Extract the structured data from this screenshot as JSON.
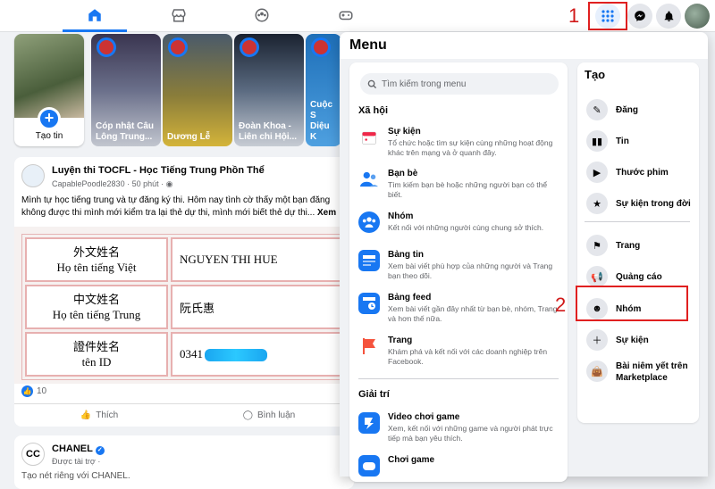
{
  "nav": {
    "home_icon": "home-icon",
    "marketplace_icon": "marketplace-icon",
    "groups_icon": "groups-icon",
    "gaming_icon": "gaming-icon",
    "accent": "#1877f2"
  },
  "annotations": {
    "step1": "1",
    "step2": "2",
    "color": "#e02020"
  },
  "stories": [
    {
      "label": "Tạo tin"
    },
    {
      "label": "Cóp nhật Câu Lông Trung..."
    },
    {
      "label": "Dương Lễ"
    },
    {
      "label": "Đoàn Khoa - Liên chi Hội..."
    },
    {
      "label": "Cuộc S Diệu K"
    }
  ],
  "post": {
    "name": "Luyện thi TOCFL - Học Tiếng Trung Phồn Thể",
    "author": "CapablePoodle2830",
    "time": "50 phút",
    "text": "Mình tự học tiếng trung và tự đăng ký thi. Hôm nay tình cờ thấy một bạn đăng không được thi mình mới kiểm tra lại thẻ dự thi, mình mới biết thẻ dự thi...",
    "see_more": "Xem",
    "table": [
      {
        "l1": "外文姓名",
        "l2": "Họ tên tiếng Việt",
        "value": "NGUYEN THI HUE"
      },
      {
        "l1": "中文姓名",
        "l2": "Họ tên tiếng Trung",
        "value": "阮氏惠"
      },
      {
        "l1": "證件姓名",
        "l2": "tên ID",
        "value": "0341"
      }
    ],
    "likes": "10",
    "like_label": "Thích",
    "comment_label": "Bình luận"
  },
  "post2": {
    "name": "CHANEL",
    "logo": "CC",
    "meta": "Được tài trợ ·",
    "text": "Tạo nét riêng với CHANEL."
  },
  "menu": {
    "title": "Menu",
    "search_placeholder": "Tìm kiếm trong menu",
    "sections": {
      "social": "Xã hội",
      "entertainment": "Giải trí"
    },
    "items": [
      {
        "title": "Sự kiện",
        "desc": "Tổ chức hoặc tìm sự kiện cùng những hoạt động khác trên mạng và ở quanh đây.",
        "icon": "calendar-icon",
        "color": "#f02849"
      },
      {
        "title": "Bạn bè",
        "desc": "Tìm kiếm bạn bè hoặc những người bạn có thể biết.",
        "icon": "friends-icon",
        "color": "#1877f2"
      },
      {
        "title": "Nhóm",
        "desc": "Kết nối với những người cùng chung sở thích.",
        "icon": "groups-icon",
        "color": "#1877f2"
      },
      {
        "title": "Bảng tin",
        "desc": "Xem bài viết phù hợp của những người và Trang bạn theo dõi.",
        "icon": "feed-icon",
        "color": "#1877f2"
      },
      {
        "title": "Bảng feed",
        "desc": "Xem bài viết gần đây nhất từ bạn bè, nhóm, Trang và hơn thế nữa.",
        "icon": "clock-feed-icon",
        "color": "#1877f2"
      },
      {
        "title": "Trang",
        "desc": "Khám phá và kết nối với các doanh nghiệp trên Facebook.",
        "icon": "flag-icon",
        "color": "#f5533d"
      },
      {
        "title": "Video chơi game",
        "desc": "Xem, kết nối với những game và người phát trực tiếp mà bạn yêu thích.",
        "icon": "gaming-video-icon",
        "color": "#1877f2"
      },
      {
        "title": "Chơi game",
        "desc": "",
        "icon": "game-icon",
        "color": "#1877f2"
      }
    ],
    "create": {
      "title": "Tạo",
      "items": [
        {
          "label": "Đăng",
          "icon": "edit-icon"
        },
        {
          "label": "Tin",
          "icon": "book-icon"
        },
        {
          "label": "Thước phim",
          "icon": "reels-icon"
        },
        {
          "label": "Sự kiện trong đời",
          "icon": "star-flag-icon"
        },
        {
          "label": "Trang",
          "icon": "flag-icon"
        },
        {
          "label": "Quảng cáo",
          "icon": "megaphone-icon"
        },
        {
          "label": "Nhóm",
          "icon": "groups-icon"
        },
        {
          "label": "Sự kiện",
          "icon": "calendar-plus-icon"
        },
        {
          "label": "Bài niêm yết trên Marketplace",
          "icon": "shopping-bag-icon"
        }
      ]
    }
  }
}
